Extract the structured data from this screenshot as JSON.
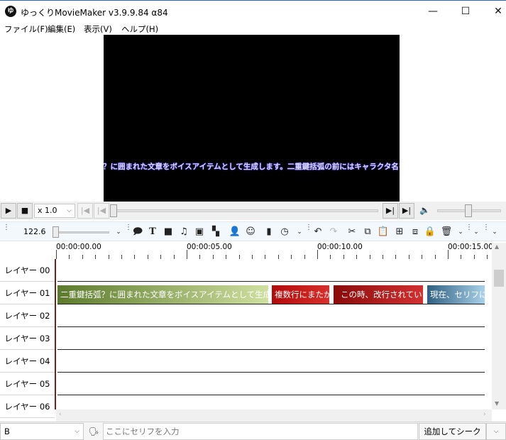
{
  "window": {
    "title": "ゆっくりMovieMaker v3.9.9.84 α84",
    "icon_glyph": "ゆ",
    "controls": {
      "minimize": "—",
      "maximize": "☐",
      "close": "✕"
    }
  },
  "menu": [
    {
      "label": "ファイル(F)"
    },
    {
      "label": "編集(E)"
    },
    {
      "label": "表示(V)"
    },
    {
      "label": "ヘルプ(H)"
    }
  ],
  "preview": {
    "subtitle": "括弧？に囲まれた文章をボイスアイテムとして生成します。二重鍵括弧の前にはキャラクタ名を"
  },
  "playback": {
    "speed": "x 1.0",
    "seek_fraction": 0.0,
    "volume_fraction": 0.5
  },
  "toolbar": {
    "zoom_value": "122.6",
    "zoom_fraction": 0.0
  },
  "timeline": {
    "ruler": [
      "00:00:00.00",
      "00:00:05.00",
      "00:00:10.00",
      "00:00:15.00"
    ],
    "layers": [
      "レイヤー 00",
      "レイヤー 01",
      "レイヤー 02",
      "レイヤー 03",
      "レイヤー 04",
      "レイヤー 05",
      "レイヤー 06"
    ],
    "clips": [
      {
        "text": "二重鍵括弧？に囲まれた文章をボイスアイテムとして生成します",
        "color_start": "#5c7a2c",
        "color_end": "#cfe0a0"
      },
      {
        "text": "複数行にまたがる",
        "color_start": "#b00a0a",
        "color_end": "#d8302c"
      },
      {
        "text": "この時、改行されている箇所",
        "color_start": "#8a0a0a",
        "color_end": "#d23030"
      },
      {
        "text": "現在、セリフには",
        "color_start": "#2f5f80",
        "color_end": "#a9d1ea"
      }
    ]
  },
  "bottom": {
    "character": "B",
    "input_placeholder": "ここにセリフを入力",
    "add_seek_label": "追加してシーク"
  },
  "colors": {
    "accent_border": "#2b6bb5",
    "playhead": "#6d2222",
    "toolbar_bg": "#f3f8fd"
  }
}
